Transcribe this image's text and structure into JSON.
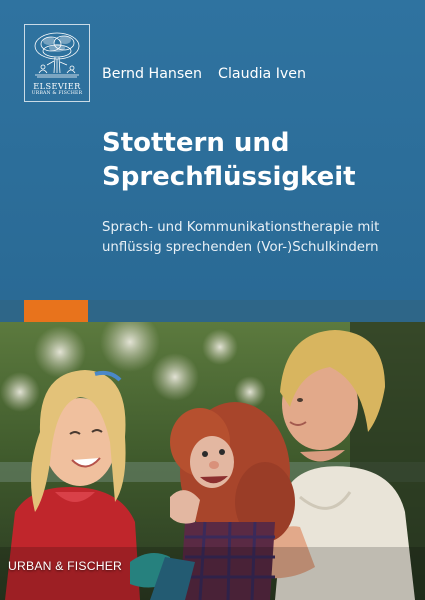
{
  "logo": {
    "name": "ELSEVIER",
    "sub": "URBAN & FISCHER"
  },
  "authors": [
    "Bernd Hansen",
    "Claudia Iven"
  ],
  "title_lines": [
    "Stottern und",
    "Sprechflüssigkeit"
  ],
  "subtitle_lines": [
    "Sprach- und Kommunikationstherapie mit",
    "unflüssig sprechenden (Vor-)Schulkindern"
  ],
  "publisher": "URBAN & FISCHER",
  "colors": {
    "cover_blue": "#2f73a0",
    "band_blue": "#2e6688",
    "accent_orange": "#e8731c"
  },
  "icons": {
    "logo": "tree-icon"
  }
}
